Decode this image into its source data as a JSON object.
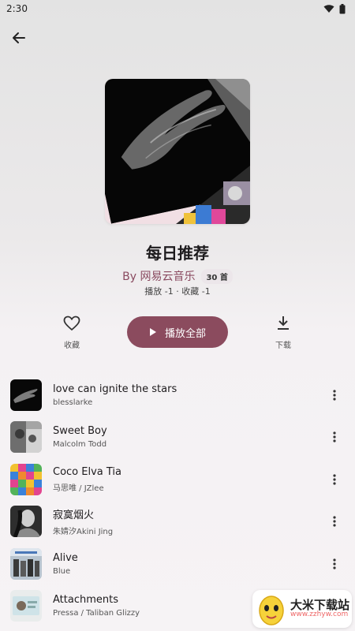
{
  "status": {
    "time": "2:30",
    "wifi_icon": "wifi-icon",
    "battery_icon": "battery-icon"
  },
  "header": {
    "back_icon": "arrow-left-icon"
  },
  "playlist": {
    "title": "每日推荐",
    "by": "By 网易云音乐",
    "count": "30 首",
    "stats": "播放 -1 · 收藏 -1"
  },
  "actions": {
    "favorite_label": "收藏",
    "play_all_label": "播放全部",
    "download_label": "下载"
  },
  "songs": [
    {
      "title": "love can ignite the stars",
      "artist": "blesslarke"
    },
    {
      "title": "Sweet Boy",
      "artist": "Malcolm Todd"
    },
    {
      "title": "Coco Elva Tia",
      "artist": "马思唯 / JZlee"
    },
    {
      "title": "寂寞烟火",
      "artist": "朱婧汐Akini Jing"
    },
    {
      "title": "Alive",
      "artist": "Blue"
    },
    {
      "title": "Attachments",
      "artist": "Pressa / Taliban Glizzy"
    }
  ],
  "watermark": {
    "title": "大米下载站",
    "url": "www.zzhyw.com"
  },
  "colors": {
    "accent": "#8b4b5e",
    "byline": "#8a4a60"
  }
}
